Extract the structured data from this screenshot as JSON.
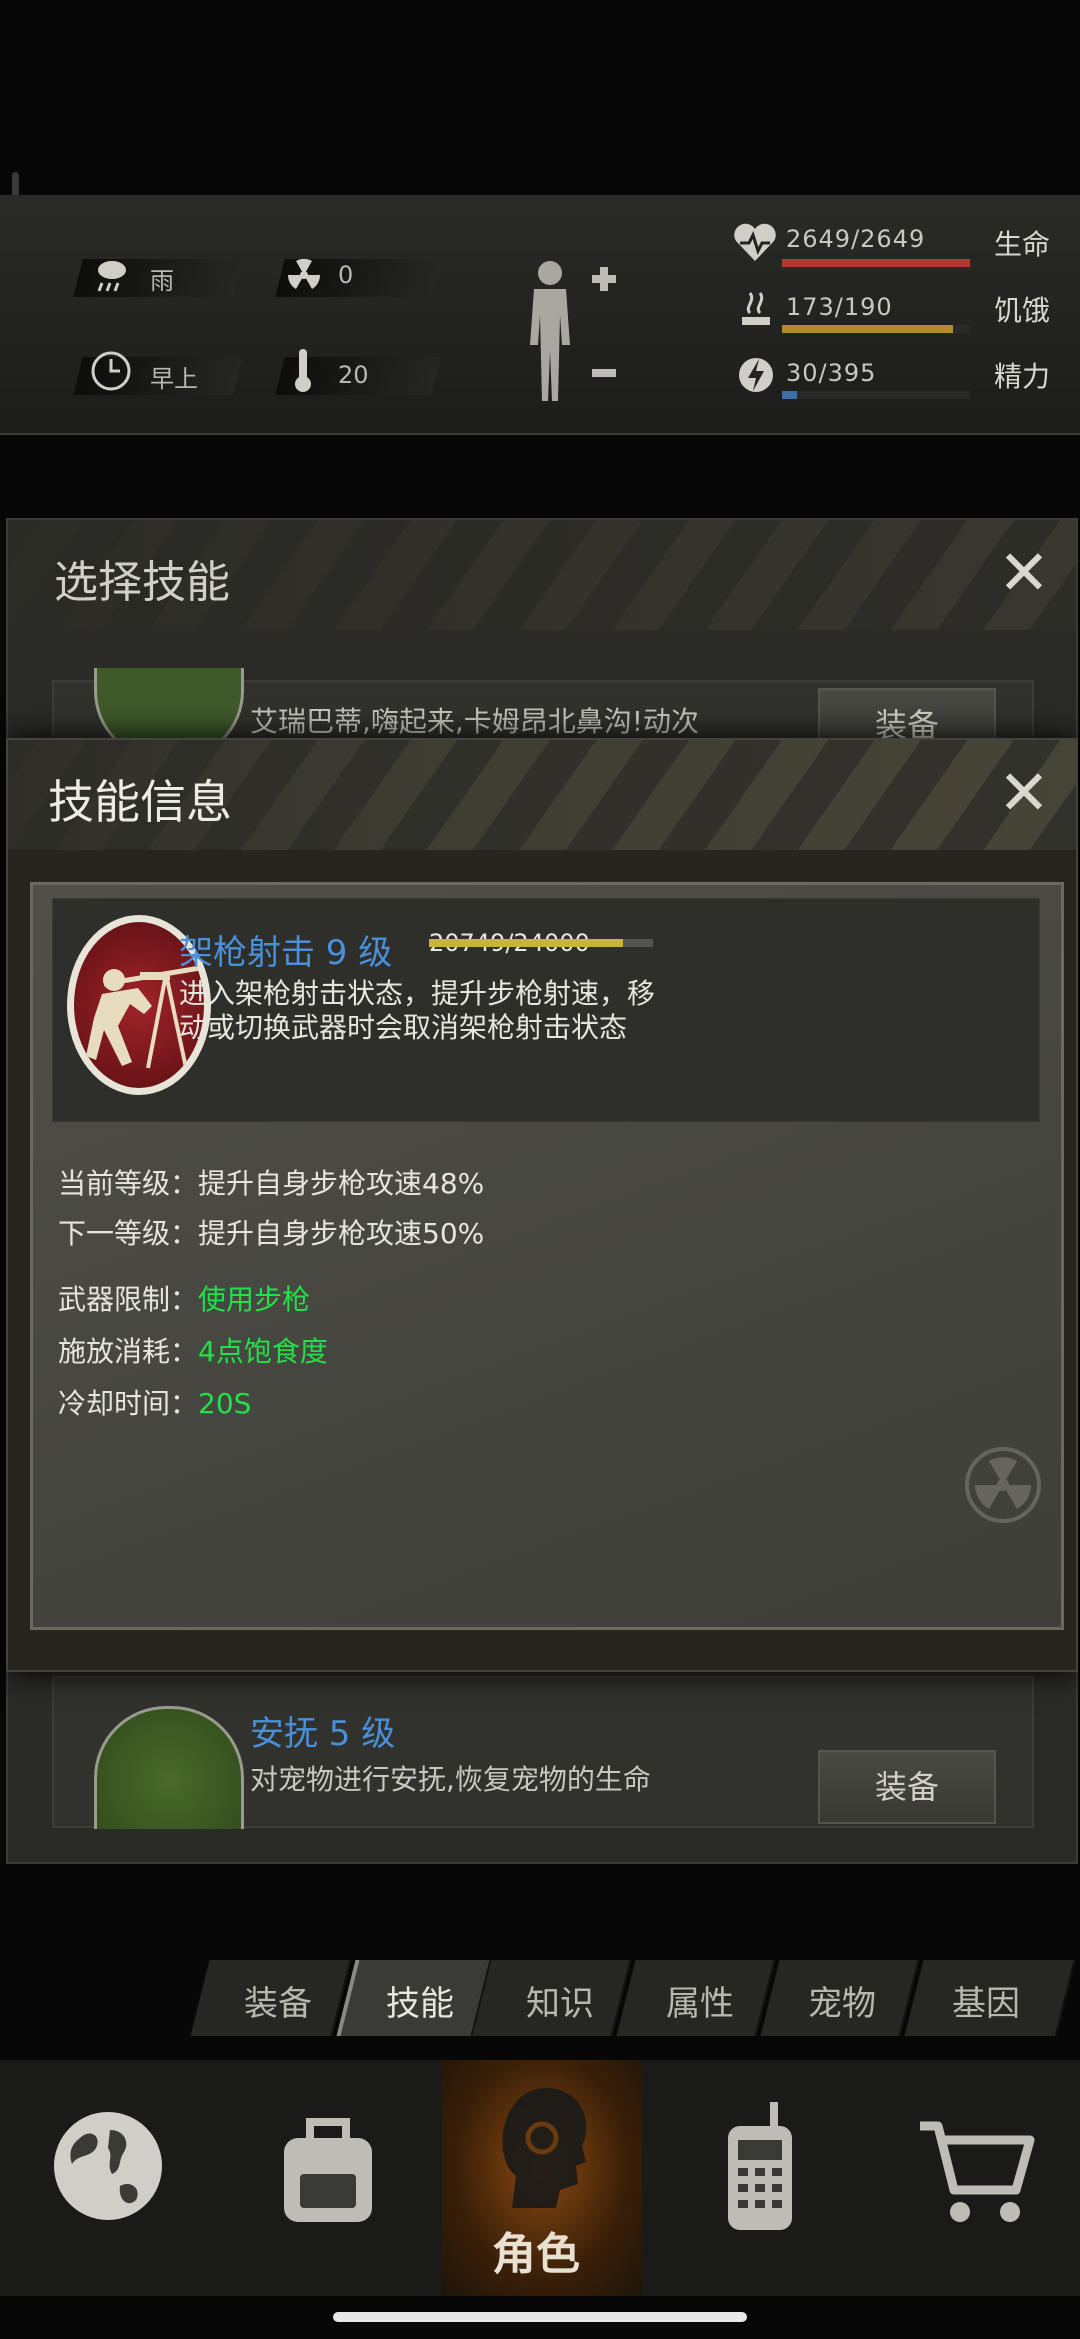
{
  "status": {
    "weather": "雨",
    "radiation": "0",
    "time_of_day": "早上",
    "temperature": "20",
    "vitals": [
      {
        "label": "生命",
        "value": "2649/2649",
        "fraction": 1.0,
        "color": "#b03a30"
      },
      {
        "label": "饥饿",
        "value": "173/190",
        "fraction": 0.91,
        "color": "#b28a2a"
      },
      {
        "label": "精力",
        "value": "30/395",
        "fraction": 0.08,
        "color": "#3d6fa8"
      }
    ]
  },
  "select_dialog": {
    "title": "选择技能",
    "skill_top_desc": "艾瑞巴蒂,嗨起来,卡姆昂北鼻沟!动次",
    "equip_label": "装备",
    "skill_bottom_name": "安抚 5 级",
    "skill_bottom_desc": "对宠物进行安抚,恢复宠物的生命"
  },
  "info_dialog": {
    "title": "技能信息",
    "skill_name": "架枪射击 9 级",
    "xp_text": "20749/24000",
    "xp_fraction": 0.8645,
    "description": "进入架枪射击状态，提升步枪射速，移动或切换武器时会取消架枪射击状态",
    "current_level_label": "当前等级：",
    "current_level_value": "提升自身步枪攻速48%",
    "next_level_label": "下一等级：",
    "next_level_value": "提升自身步枪攻速50%",
    "weapon_label": "武器限制：",
    "weapon_value": "使用步枪",
    "cost_label": "施放消耗：",
    "cost_value": "4点饱食度",
    "cooldown_label": "冷却时间：",
    "cooldown_value": "20S"
  },
  "subtabs": [
    "装备",
    "技能",
    "知识",
    "属性",
    "宠物",
    "基因"
  ],
  "active_subtab": "技能",
  "bottom_nav": {
    "active_label": "角色",
    "items": [
      "globe-icon",
      "backpack-icon",
      "character-icon",
      "radio-icon",
      "cart-icon"
    ]
  },
  "colors": {
    "accent_blue": "#4a90d9",
    "green_value": "#22e04a",
    "xp_bar": "#c8b43c"
  }
}
